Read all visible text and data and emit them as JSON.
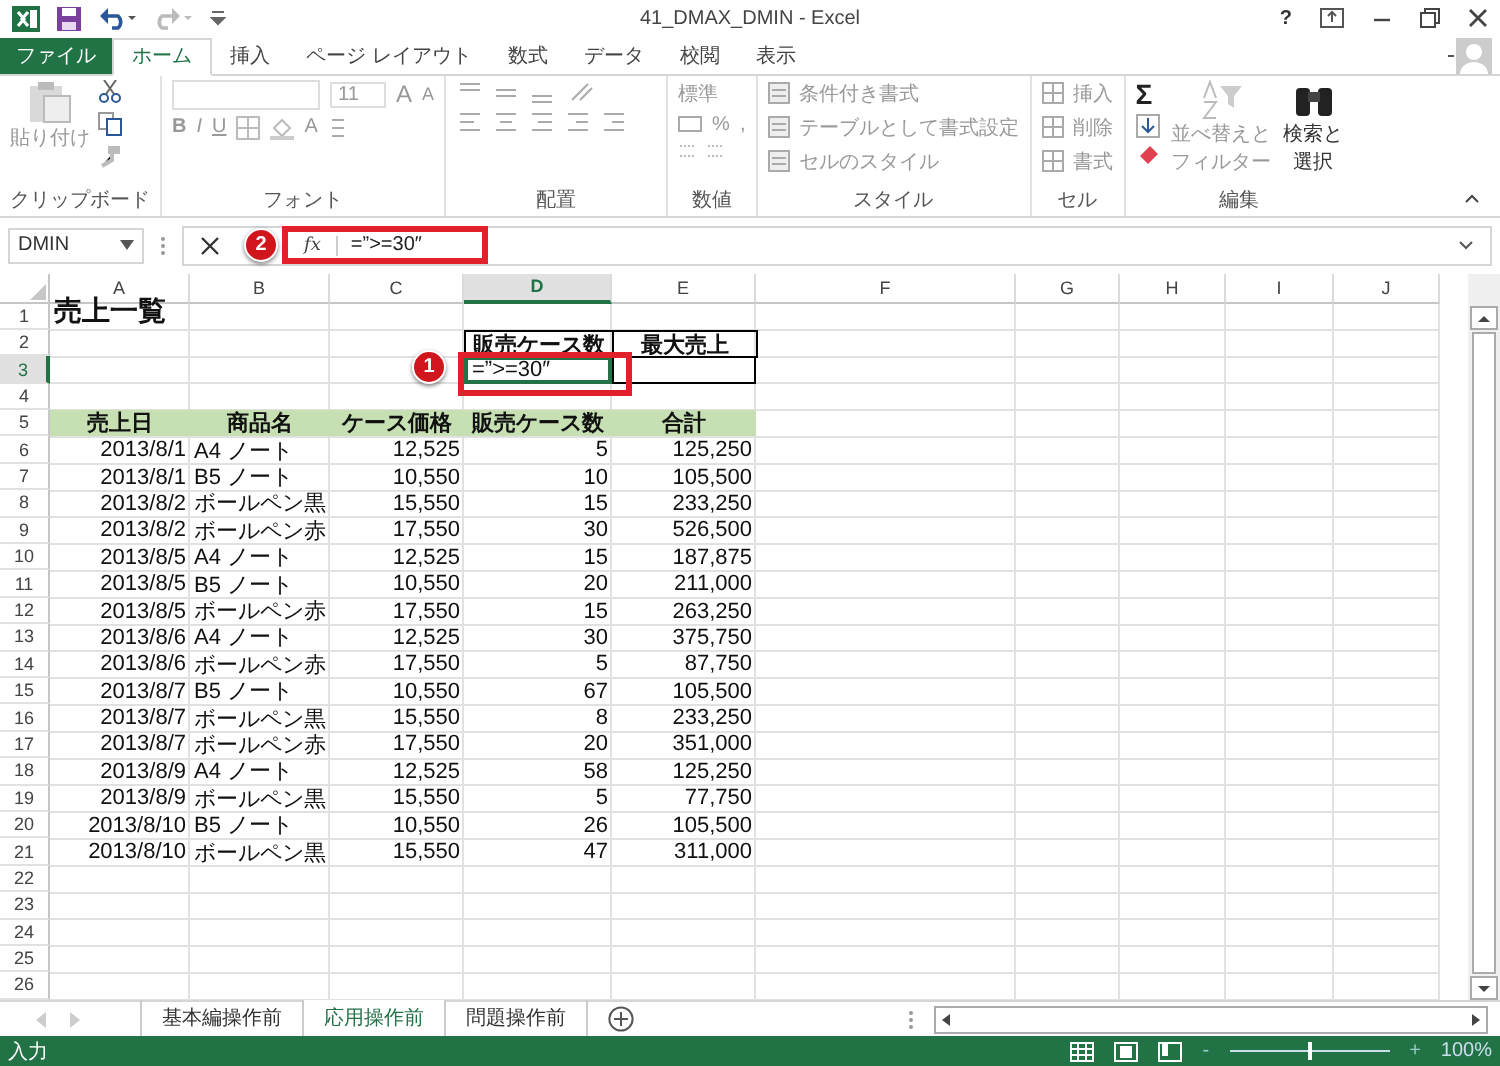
{
  "window": {
    "title": "41_DMAX_DMIN - Excel",
    "help": "?"
  },
  "ribbon_tabs": [
    {
      "label": "ファイル",
      "kind": "file",
      "selected": false
    },
    {
      "label": "ホーム",
      "kind": "tab",
      "selected": true
    },
    {
      "label": "挿入",
      "kind": "tab",
      "selected": false
    },
    {
      "label": "ページ レイアウト",
      "kind": "tab",
      "selected": false
    },
    {
      "label": "数式",
      "kind": "tab",
      "selected": false
    },
    {
      "label": "データ",
      "kind": "tab",
      "selected": false
    },
    {
      "label": "校閲",
      "kind": "tab",
      "selected": false
    },
    {
      "label": "表示",
      "kind": "tab",
      "selected": false
    }
  ],
  "ribbon": {
    "clipboard": {
      "paste": "貼り付け",
      "label": "クリップボード"
    },
    "font": {
      "size": "11",
      "grow": "A",
      "shrink": "A",
      "bold": "B",
      "italic": "I",
      "underline": "U",
      "font_color_button": "A",
      "label": "フォント"
    },
    "alignment": {
      "label": "配置"
    },
    "number": {
      "format": "標準",
      "percent": "%",
      "comma": ",",
      "label": "数値"
    },
    "styles": {
      "items": [
        "条件付き書式",
        "テーブルとして書式設定",
        "セルのスタイル"
      ],
      "label": "スタイル"
    },
    "cells": {
      "items": [
        "挿入",
        "削除",
        "書式"
      ],
      "label": "セル"
    },
    "editing": {
      "sigma": "Σ",
      "sort": [
        "並べ替えと",
        "フィルター"
      ],
      "find": [
        "検索と",
        "選択"
      ],
      "label": "編集"
    }
  },
  "formula_bar": {
    "name_box": "DMIN",
    "fx": "fx",
    "formula": "=”>=30″"
  },
  "callouts": [
    {
      "number": "1",
      "kind": "cell"
    },
    {
      "number": "2",
      "kind": "formula"
    }
  ],
  "sheet": {
    "columns": [
      {
        "label": "A",
        "selected": false
      },
      {
        "label": "B",
        "selected": false
      },
      {
        "label": "C",
        "selected": false
      },
      {
        "label": "D",
        "selected": true
      },
      {
        "label": "E",
        "selected": false
      },
      {
        "label": "F",
        "selected": false
      },
      {
        "label": "G",
        "selected": false
      },
      {
        "label": "H",
        "selected": false
      },
      {
        "label": "I",
        "selected": false
      },
      {
        "label": "J",
        "selected": false
      }
    ],
    "row_numbers": [
      {
        "label": "1",
        "selected": false
      },
      {
        "label": "2",
        "selected": false
      },
      {
        "label": "3",
        "selected": true
      },
      {
        "label": "4",
        "selected": false
      },
      {
        "label": "5",
        "selected": false
      },
      {
        "label": "6",
        "selected": false
      },
      {
        "label": "7",
        "selected": false
      },
      {
        "label": "8",
        "selected": false
      },
      {
        "label": "9",
        "selected": false
      },
      {
        "label": "10",
        "selected": false
      },
      {
        "label": "11",
        "selected": false
      },
      {
        "label": "12",
        "selected": false
      },
      {
        "label": "13",
        "selected": false
      },
      {
        "label": "14",
        "selected": false
      },
      {
        "label": "15",
        "selected": false
      },
      {
        "label": "16",
        "selected": false
      },
      {
        "label": "17",
        "selected": false
      },
      {
        "label": "18",
        "selected": false
      },
      {
        "label": "19",
        "selected": false
      },
      {
        "label": "20",
        "selected": false
      },
      {
        "label": "21",
        "selected": false
      },
      {
        "label": "22",
        "selected": false
      },
      {
        "label": "23",
        "selected": false
      },
      {
        "label": "24",
        "selected": false
      },
      {
        "label": "25",
        "selected": false
      },
      {
        "label": "26",
        "selected": false
      }
    ],
    "title": "売上一覧",
    "criteria": {
      "headers": [
        "販売ケース数",
        "最大売上"
      ],
      "editing_value": "=”>=30″"
    },
    "table": {
      "headers": [
        "売上日",
        "商品名",
        "ケース価格",
        "販売ケース数",
        "合計"
      ],
      "rows": [
        [
          "2013/8/1",
          "A4 ノート",
          "12,525",
          "5",
          "125,250"
        ],
        [
          "2013/8/1",
          "B5 ノート",
          "10,550",
          "10",
          "105,500"
        ],
        [
          "2013/8/2",
          "ボールペン黒",
          "15,550",
          "15",
          "233,250"
        ],
        [
          "2013/8/2",
          "ボールペン赤",
          "17,550",
          "30",
          "526,500"
        ],
        [
          "2013/8/5",
          "A4 ノート",
          "12,525",
          "15",
          "187,875"
        ],
        [
          "2013/8/5",
          "B5 ノート",
          "10,550",
          "20",
          "211,000"
        ],
        [
          "2013/8/5",
          "ボールペン赤",
          "17,550",
          "15",
          "263,250"
        ],
        [
          "2013/8/6",
          "A4 ノート",
          "12,525",
          "30",
          "375,750"
        ],
        [
          "2013/8/6",
          "ボールペン赤",
          "17,550",
          "5",
          "87,750"
        ],
        [
          "2013/8/7",
          "B5 ノート",
          "10,550",
          "67",
          "105,500"
        ],
        [
          "2013/8/7",
          "ボールペン黒",
          "15,550",
          "8",
          "233,250"
        ],
        [
          "2013/8/7",
          "ボールペン赤",
          "17,550",
          "20",
          "351,000"
        ],
        [
          "2013/8/9",
          "A4 ノート",
          "12,525",
          "58",
          "125,250"
        ],
        [
          "2013/8/9",
          "ボールペン黒",
          "15,550",
          "5",
          "77,750"
        ],
        [
          "2013/8/10",
          "B5 ノート",
          "10,550",
          "26",
          "105,500"
        ],
        [
          "2013/8/10",
          "ボールペン黒",
          "15,550",
          "47",
          "311,000"
        ]
      ]
    }
  },
  "sheet_tabs": [
    {
      "label": "基本編操作前",
      "selected": false
    },
    {
      "label": "応用操作前",
      "selected": true
    },
    {
      "label": "問題操作前",
      "selected": false
    }
  ],
  "status_bar": {
    "mode": "入力",
    "zoom": "100%",
    "zoom_out": "-",
    "zoom_in": "+",
    "zoom_slider": {
      "level": 0.5
    }
  }
}
